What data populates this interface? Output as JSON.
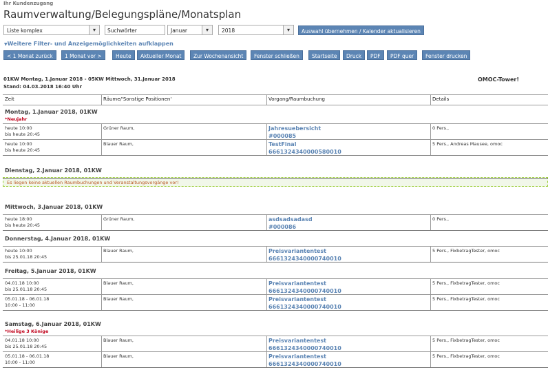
{
  "header": {
    "kundenzugang": "Ihr Kundenzugang",
    "title": "Raumverwaltung/Belegungspläne/Monatsplan"
  },
  "controls": {
    "view_select": "Liste komplex",
    "search_placeholder": "Suchwörter",
    "month_select": "Januar",
    "year_select": "2018",
    "apply_button": "Auswahl übernehmen / Kalender aktualisieren",
    "filter_toggle": "Weitere Filter- und Anzeigemöglichkeiten aufklappen"
  },
  "toolbar": {
    "prev_month": "< 1 Monat zurück",
    "next_month": "1 Monat vor >",
    "today": "Heute",
    "current_month": "Aktueller Monat",
    "week_view": "Zur Wochenansicht",
    "close_window": "Fenster schließen",
    "start_page": "Startseite",
    "print": "Druck",
    "pdf": "PDF",
    "pdf_landscape": "PDF quer",
    "print_window": "Fenster drucken"
  },
  "info": {
    "range": "01KW Montag, 1.Januar 2018 - 05KW Mittwoch, 31.Januar 2018",
    "stand": "Stand: 04.03.2018 16:40 Uhr",
    "location": "OMOC-Tower!"
  },
  "table": {
    "columns": [
      "Zeit",
      "Räume/'Sonstige Positionen'",
      "Vorgang/Raumbuchung",
      "Details"
    ],
    "days": [
      {
        "label": "Montag, 1.Januar 2018, 01KW",
        "holiday": "*Neujahr",
        "rows": [
          {
            "time1": "heute 10:00",
            "time2": "bis heute 20:45",
            "room": "Grüner Raum,",
            "link1": "Jahresuebersicht",
            "link2": "#000085",
            "details": "0 Pers.,"
          },
          {
            "time1": "heute 10:00",
            "time2": "bis heute 20:45",
            "room": "Blauer Raum,",
            "link1": "TestFinal",
            "link2": "6661324340000580010",
            "details": "5 Pers., Andreas Mausee, omoc"
          }
        ]
      },
      {
        "label": "Dienstag, 2.Januar 2018, 01KW",
        "note": "Es liegen keine aktuellen Raumbuchungen und Veranstaltungsvorgänge vor!"
      },
      {
        "label": "Mittwoch, 3.Januar 2018, 01KW",
        "rows": [
          {
            "time1": "heute 18:00",
            "time2": "bis heute 20:45",
            "room": "Grüner Raum,",
            "link1": "asdsadsadasd",
            "link2": "#000086",
            "details": "0 Pers.,"
          }
        ]
      },
      {
        "label": "Donnerstag, 4.Januar 2018, 01KW",
        "rows": [
          {
            "time1": "heute 10:00",
            "time2": "bis 25.01.18 20:45",
            "room": "Blauer Raum,",
            "link1": "Preisvariantentest",
            "link2": "6661324340000740010",
            "details": "5 Pers., FixbetragTester, omoc"
          }
        ]
      },
      {
        "label": "Freitag, 5.Januar 2018, 01KW",
        "rows": [
          {
            "time1": "04.01.18 10:00",
            "time2": "bis 25.01.18 20:45",
            "room": "Blauer Raum,",
            "link1": "Preisvariantentest",
            "link2": "6661324340000740010",
            "details": "5 Pers., FixbetragTester, omoc"
          },
          {
            "time1": "05.01.18 - 06.01.18",
            "time2": "10:00 - 11:00",
            "room": "Blauer Raum,",
            "link1": "Preisvariantentest",
            "link2": "6661324340000740010",
            "details": "5 Pers., FixbetragTester, omoc"
          }
        ]
      },
      {
        "label": "Samstag, 6.Januar 2018, 01KW",
        "holiday": "*Heilige 3 Könige",
        "rows": [
          {
            "time1": "04.01.18 10:00",
            "time2": "bis 25.01.18 20:45",
            "room": "Blauer Raum,",
            "link1": "Preisvariantentest",
            "link2": "6661324340000740010",
            "details": "5 Pers., FixbetragTester, omoc"
          },
          {
            "time1": "05.01.18 - 06.01.18",
            "time2": "10:00 - 11:00",
            "room": "Blauer Raum,",
            "link1": "Preisvariantentest",
            "link2": "6661324340000740010",
            "details": "5 Pers., FixbetragTester, omoc"
          }
        ]
      }
    ]
  }
}
